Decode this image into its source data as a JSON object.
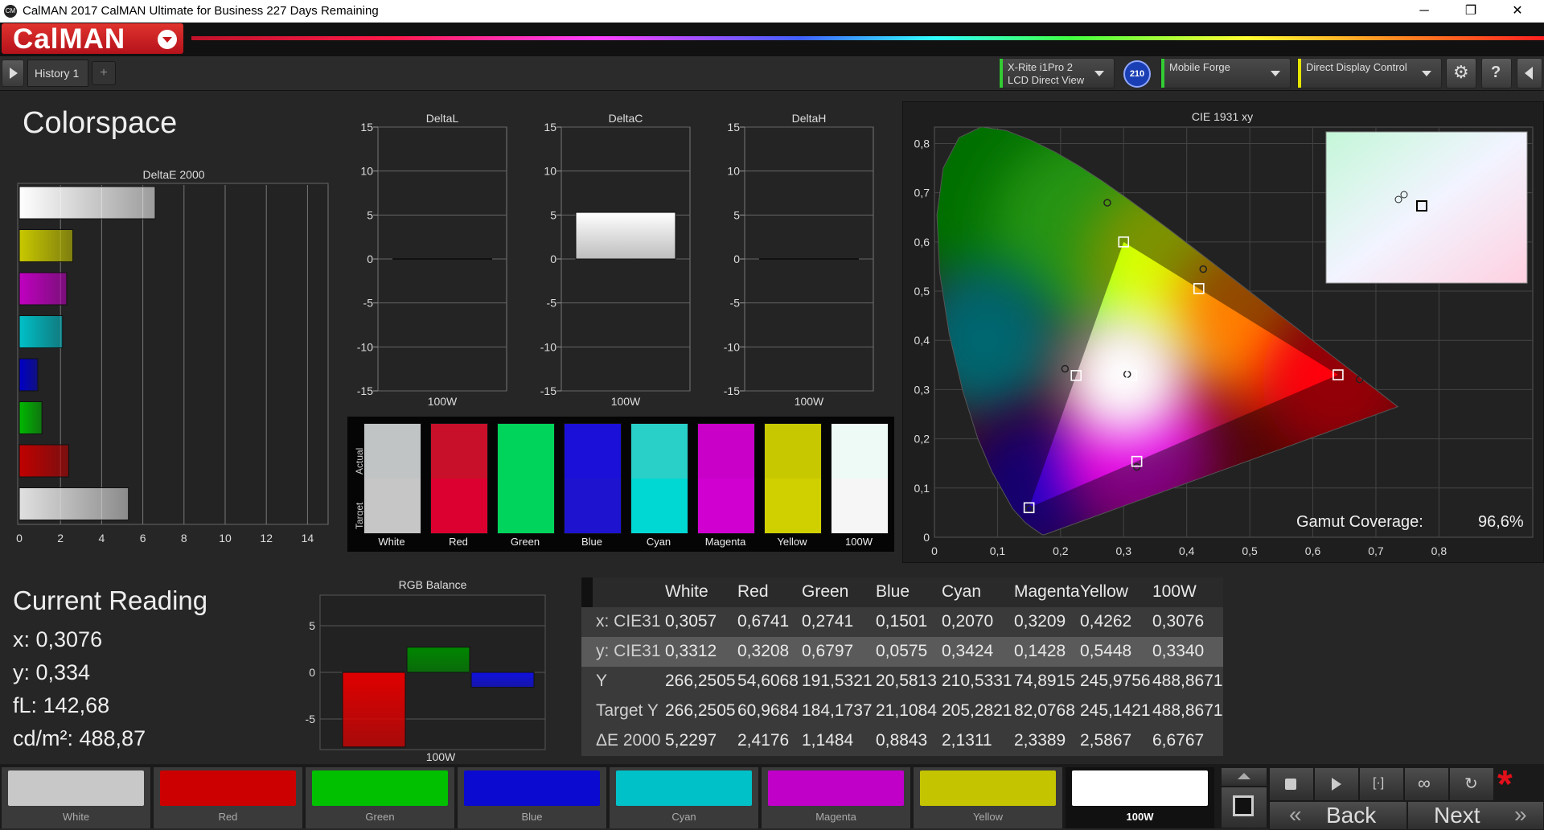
{
  "window": {
    "title": "CalMAN 2017 CalMAN Ultimate for Business 227 Days Remaining",
    "icon_text": "CM",
    "minimize": "─",
    "restore": "❐",
    "close": "✕"
  },
  "header": {
    "logo_text": "CalMAN"
  },
  "toolbar": {
    "tab_label": "History 1",
    "add_tab": "+",
    "devices": [
      {
        "line1": "X-Rite i1Pro 2",
        "line2": "LCD Direct View",
        "color": "#33cc33"
      },
      {
        "line1": "Mobile Forge",
        "line2": "",
        "color": "#33cc33"
      },
      {
        "line1": "Direct Display Control",
        "line2": "",
        "color": "#e6e600"
      }
    ],
    "badge": "210",
    "settings_icon": "gear-icon",
    "help_label": "?"
  },
  "colorspace": {
    "title": "Colorspace",
    "deltae_title": "DeltaE 2000",
    "x_ticks": [
      "0",
      "2",
      "4",
      "6",
      "8",
      "10",
      "12",
      "14"
    ],
    "bars": [
      {
        "name": "White",
        "value": 6.6,
        "color": "#ffffff"
      },
      {
        "name": "Yellow",
        "value": 2.6,
        "color": "#c8c800"
      },
      {
        "name": "Magenta",
        "value": 2.3,
        "color": "#c000c0"
      },
      {
        "name": "Cyan",
        "value": 2.1,
        "color": "#00c0c8"
      },
      {
        "name": "Blue",
        "value": 0.9,
        "color": "#0000c8"
      },
      {
        "name": "Green",
        "value": 1.1,
        "color": "#00b800"
      },
      {
        "name": "Red",
        "value": 2.4,
        "color": "#c00000"
      },
      {
        "name": "100W",
        "value": 5.3,
        "color": "#e0e0e0"
      }
    ]
  },
  "delta_charts": [
    {
      "title": "DeltaL",
      "value": 0,
      "xlabel": "100W"
    },
    {
      "title": "DeltaC",
      "value": 5.3,
      "xlabel": "100W"
    },
    {
      "title": "DeltaH",
      "value": 0,
      "xlabel": "100W"
    }
  ],
  "delta_ticks": [
    "15",
    "10",
    "5",
    "0",
    "-5",
    "-10",
    "-15"
  ],
  "swatch_compare": {
    "actual_label": "Actual",
    "target_label": "Target",
    "items": [
      {
        "name": "White",
        "actual": "#c0c4c4",
        "target": "#c6c6c6"
      },
      {
        "name": "Red",
        "actual": "#c8102a",
        "target": "#dc0030"
      },
      {
        "name": "Green",
        "actual": "#00d45a",
        "target": "#00d45c"
      },
      {
        "name": "Blue",
        "actual": "#1a10d8",
        "target": "#1e14d0"
      },
      {
        "name": "Cyan",
        "actual": "#28d0c8",
        "target": "#00d8d4"
      },
      {
        "name": "Magenta",
        "actual": "#c800c8",
        "target": "#d000d0"
      },
      {
        "name": "Yellow",
        "actual": "#c8c800",
        "target": "#d0d000"
      },
      {
        "name": "100W",
        "actual": "#eefaf6",
        "target": "#f6f6f6"
      }
    ]
  },
  "cie": {
    "title": "CIE 1931 xy",
    "gamut_label": "Gamut Coverage:",
    "gamut_value": "96,6%",
    "x_ticks": [
      "0",
      "0,1",
      "0,2",
      "0,3",
      "0,4",
      "0,5",
      "0,6",
      "0,7",
      "0,8"
    ],
    "y_ticks": [
      "0",
      "0,1",
      "0,2",
      "0,3",
      "0,4",
      "0,5",
      "0,6",
      "0,7",
      "0,8"
    ],
    "targets": [
      {
        "name": "Red",
        "x": 0.64,
        "y": 0.33
      },
      {
        "name": "Green",
        "x": 0.3,
        "y": 0.6
      },
      {
        "name": "Blue",
        "x": 0.15,
        "y": 0.06
      },
      {
        "name": "Cyan",
        "x": 0.2247,
        "y": 0.3287
      },
      {
        "name": "Magenta",
        "x": 0.3209,
        "y": 0.1542
      },
      {
        "name": "Yellow",
        "x": 0.4193,
        "y": 0.5053
      },
      {
        "name": "White",
        "x": 0.3127,
        "y": 0.329
      }
    ],
    "measured": [
      {
        "name": "Red",
        "x": 0.6741,
        "y": 0.3208
      },
      {
        "name": "Green",
        "x": 0.2741,
        "y": 0.6797
      },
      {
        "name": "Blue",
        "x": 0.1501,
        "y": 0.0575
      },
      {
        "name": "Cyan",
        "x": 0.207,
        "y": 0.3424
      },
      {
        "name": "Magenta",
        "x": 0.3209,
        "y": 0.1428
      },
      {
        "name": "Yellow",
        "x": 0.4262,
        "y": 0.5448
      },
      {
        "name": "White",
        "x": 0.3057,
        "y": 0.3312
      }
    ]
  },
  "current_reading": {
    "title": "Current Reading",
    "x": "x: 0,3076",
    "y": "y: 0,334",
    "fl": "fL: 142,68",
    "cdm2": "cd/m²: 488,87"
  },
  "rgb_balance": {
    "title": "RGB Balance",
    "xlabel": "100W",
    "ticks": [
      "5",
      "0",
      "-5"
    ],
    "values": [
      {
        "name": "R",
        "value": -8,
        "color": "#e00000"
      },
      {
        "name": "G",
        "value": 2.7,
        "color": "#008800"
      },
      {
        "name": "B",
        "value": -1.6,
        "color": "#1010e0"
      }
    ]
  },
  "table": {
    "headers": [
      "",
      "White",
      "Red",
      "Green",
      "Blue",
      "Cyan",
      "Magenta",
      "Yellow",
      "100W"
    ],
    "rows": [
      [
        "x: CIE31",
        "0,3057",
        "0,6741",
        "0,2741",
        "0,1501",
        "0,2070",
        "0,3209",
        "0,4262",
        "0,3076"
      ],
      [
        "y: CIE31",
        "0,3312",
        "0,3208",
        "0,6797",
        "0,0575",
        "0,3424",
        "0,1428",
        "0,5448",
        "0,3340"
      ],
      [
        "Y",
        "266,2505",
        "54,6068",
        "191,5321",
        "20,5813",
        "210,5331",
        "74,8915",
        "245,9756",
        "488,8671"
      ],
      [
        "Target Y",
        "266,2505",
        "60,9684",
        "184,1737",
        "21,1084",
        "205,2821",
        "82,0768",
        "245,1421",
        "488,8671"
      ],
      [
        "ΔE 2000",
        "5,2297",
        "2,4176",
        "1,1484",
        "0,8843",
        "2,1311",
        "2,3389",
        "2,5867",
        "6,6767"
      ]
    ]
  },
  "patch_bar": [
    {
      "name": "White",
      "color": "#c8c8c8"
    },
    {
      "name": "Red",
      "color": "#cc0000"
    },
    {
      "name": "Green",
      "color": "#00c000"
    },
    {
      "name": "Blue",
      "color": "#0a0ad0"
    },
    {
      "name": "Cyan",
      "color": "#00c0c8"
    },
    {
      "name": "Magenta",
      "color": "#c000c8"
    },
    {
      "name": "Yellow",
      "color": "#c4c400"
    },
    {
      "name": "100W",
      "color": "#ffffff"
    }
  ],
  "nav": {
    "back_label": "Back",
    "next_label": "Next",
    "back_glyph": "«",
    "next_glyph": "»"
  }
}
